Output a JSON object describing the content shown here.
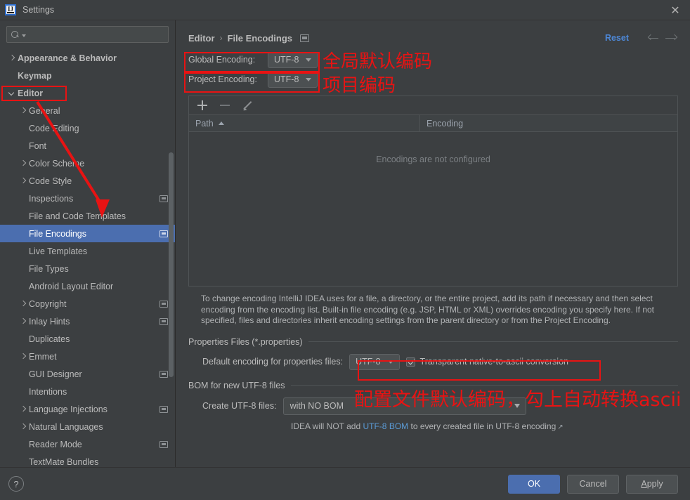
{
  "window": {
    "title": "Settings",
    "app_icon": "intellij-idea-logo",
    "close_icon": "close-icon"
  },
  "sidebar": {
    "search": {
      "placeholder": "",
      "value": "",
      "icon": "search-icon"
    },
    "items": [
      {
        "label": "Appearance & Behavior",
        "arrow": "right",
        "indent": 0,
        "bold": true,
        "badge": false,
        "selected": false
      },
      {
        "label": "Keymap",
        "arrow": "none",
        "indent": 0,
        "bold": true,
        "badge": false,
        "selected": false
      },
      {
        "label": "Editor",
        "arrow": "down",
        "indent": 0,
        "bold": true,
        "badge": false,
        "selected": false
      },
      {
        "label": "General",
        "arrow": "right",
        "indent": 1,
        "bold": false,
        "badge": false,
        "selected": false
      },
      {
        "label": "Code Editing",
        "arrow": "none",
        "indent": 1,
        "bold": false,
        "badge": false,
        "selected": false
      },
      {
        "label": "Font",
        "arrow": "none",
        "indent": 1,
        "bold": false,
        "badge": false,
        "selected": false
      },
      {
        "label": "Color Scheme",
        "arrow": "right",
        "indent": 1,
        "bold": false,
        "badge": false,
        "selected": false
      },
      {
        "label": "Code Style",
        "arrow": "right",
        "indent": 1,
        "bold": false,
        "badge": false,
        "selected": false
      },
      {
        "label": "Inspections",
        "arrow": "none",
        "indent": 1,
        "bold": false,
        "badge": true,
        "selected": false
      },
      {
        "label": "File and Code Templates",
        "arrow": "none",
        "indent": 1,
        "bold": false,
        "badge": false,
        "selected": false
      },
      {
        "label": "File Encodings",
        "arrow": "none",
        "indent": 1,
        "bold": false,
        "badge": true,
        "selected": true
      },
      {
        "label": "Live Templates",
        "arrow": "none",
        "indent": 1,
        "bold": false,
        "badge": false,
        "selected": false
      },
      {
        "label": "File Types",
        "arrow": "none",
        "indent": 1,
        "bold": false,
        "badge": false,
        "selected": false
      },
      {
        "label": "Android Layout Editor",
        "arrow": "none",
        "indent": 1,
        "bold": false,
        "badge": false,
        "selected": false
      },
      {
        "label": "Copyright",
        "arrow": "right",
        "indent": 1,
        "bold": false,
        "badge": true,
        "selected": false
      },
      {
        "label": "Inlay Hints",
        "arrow": "right",
        "indent": 1,
        "bold": false,
        "badge": true,
        "selected": false
      },
      {
        "label": "Duplicates",
        "arrow": "none",
        "indent": 1,
        "bold": false,
        "badge": false,
        "selected": false
      },
      {
        "label": "Emmet",
        "arrow": "right",
        "indent": 1,
        "bold": false,
        "badge": false,
        "selected": false
      },
      {
        "label": "GUI Designer",
        "arrow": "none",
        "indent": 1,
        "bold": false,
        "badge": true,
        "selected": false
      },
      {
        "label": "Intentions",
        "arrow": "none",
        "indent": 1,
        "bold": false,
        "badge": false,
        "selected": false
      },
      {
        "label": "Language Injections",
        "arrow": "right",
        "indent": 1,
        "bold": false,
        "badge": true,
        "selected": false
      },
      {
        "label": "Natural Languages",
        "arrow": "right",
        "indent": 1,
        "bold": false,
        "badge": false,
        "selected": false
      },
      {
        "label": "Reader Mode",
        "arrow": "none",
        "indent": 1,
        "bold": false,
        "badge": true,
        "selected": false
      },
      {
        "label": "TextMate Bundles",
        "arrow": "none",
        "indent": 1,
        "bold": false,
        "badge": false,
        "selected": false
      }
    ]
  },
  "header": {
    "breadcrumb_parent": "Editor",
    "breadcrumb_separator": "›",
    "breadcrumb_current": "File Encodings",
    "reset_label": "Reset",
    "back_icon": "arrow-left-icon",
    "forward_icon": "arrow-right-icon"
  },
  "encodings": {
    "global_label": "Global Encoding:",
    "global_value": "UTF-8",
    "project_label": "Project Encoding:",
    "project_value": "UTF-8"
  },
  "table": {
    "toolbar": {
      "add_icon": "plus-icon",
      "remove_icon": "minus-icon",
      "edit_icon": "pencil-icon"
    },
    "columns": [
      "Path",
      "Encoding"
    ],
    "sort_indicator": "sort-ascending-icon",
    "rows": [],
    "empty_message": "Encodings are not configured"
  },
  "help_text": "To change encoding IntelliJ IDEA uses for a file, a directory, or the entire project, add its path if necessary and then select encoding from the encoding list. Built-in file encoding (e.g. JSP, HTML or XML) overrides encoding you specify here. If not specified, files and directories inherit encoding settings from the parent directory or from the Project Encoding.",
  "properties_section": {
    "title": "Properties Files (*.properties)",
    "default_encoding_label": "Default encoding for properties files:",
    "default_encoding_value": "UTF-8",
    "transparent_checkbox_label": "Transparent native-to-ascii conversion",
    "transparent_checked": true
  },
  "bom_section": {
    "title": "BOM for new UTF-8 files",
    "create_label": "Create UTF-8 files:",
    "create_value": "with NO BOM",
    "note_prefix": "IDEA will NOT add ",
    "note_link": "UTF-8 BOM",
    "note_suffix": " to every created file in UTF-8 encoding",
    "external_link_icon": "external-link-icon"
  },
  "footer": {
    "help_icon": "question-mark-icon",
    "ok_label": "OK",
    "cancel_label": "Cancel",
    "apply_label_prefix": "A",
    "apply_label_rest": "pply"
  },
  "annotations": {
    "global_encoding_cn": "全局默认编码",
    "project_encoding_cn": "项目编码",
    "properties_cn": "配置文件默认编码，勾上自动转换ascii",
    "highlight_color": "#e81313"
  }
}
